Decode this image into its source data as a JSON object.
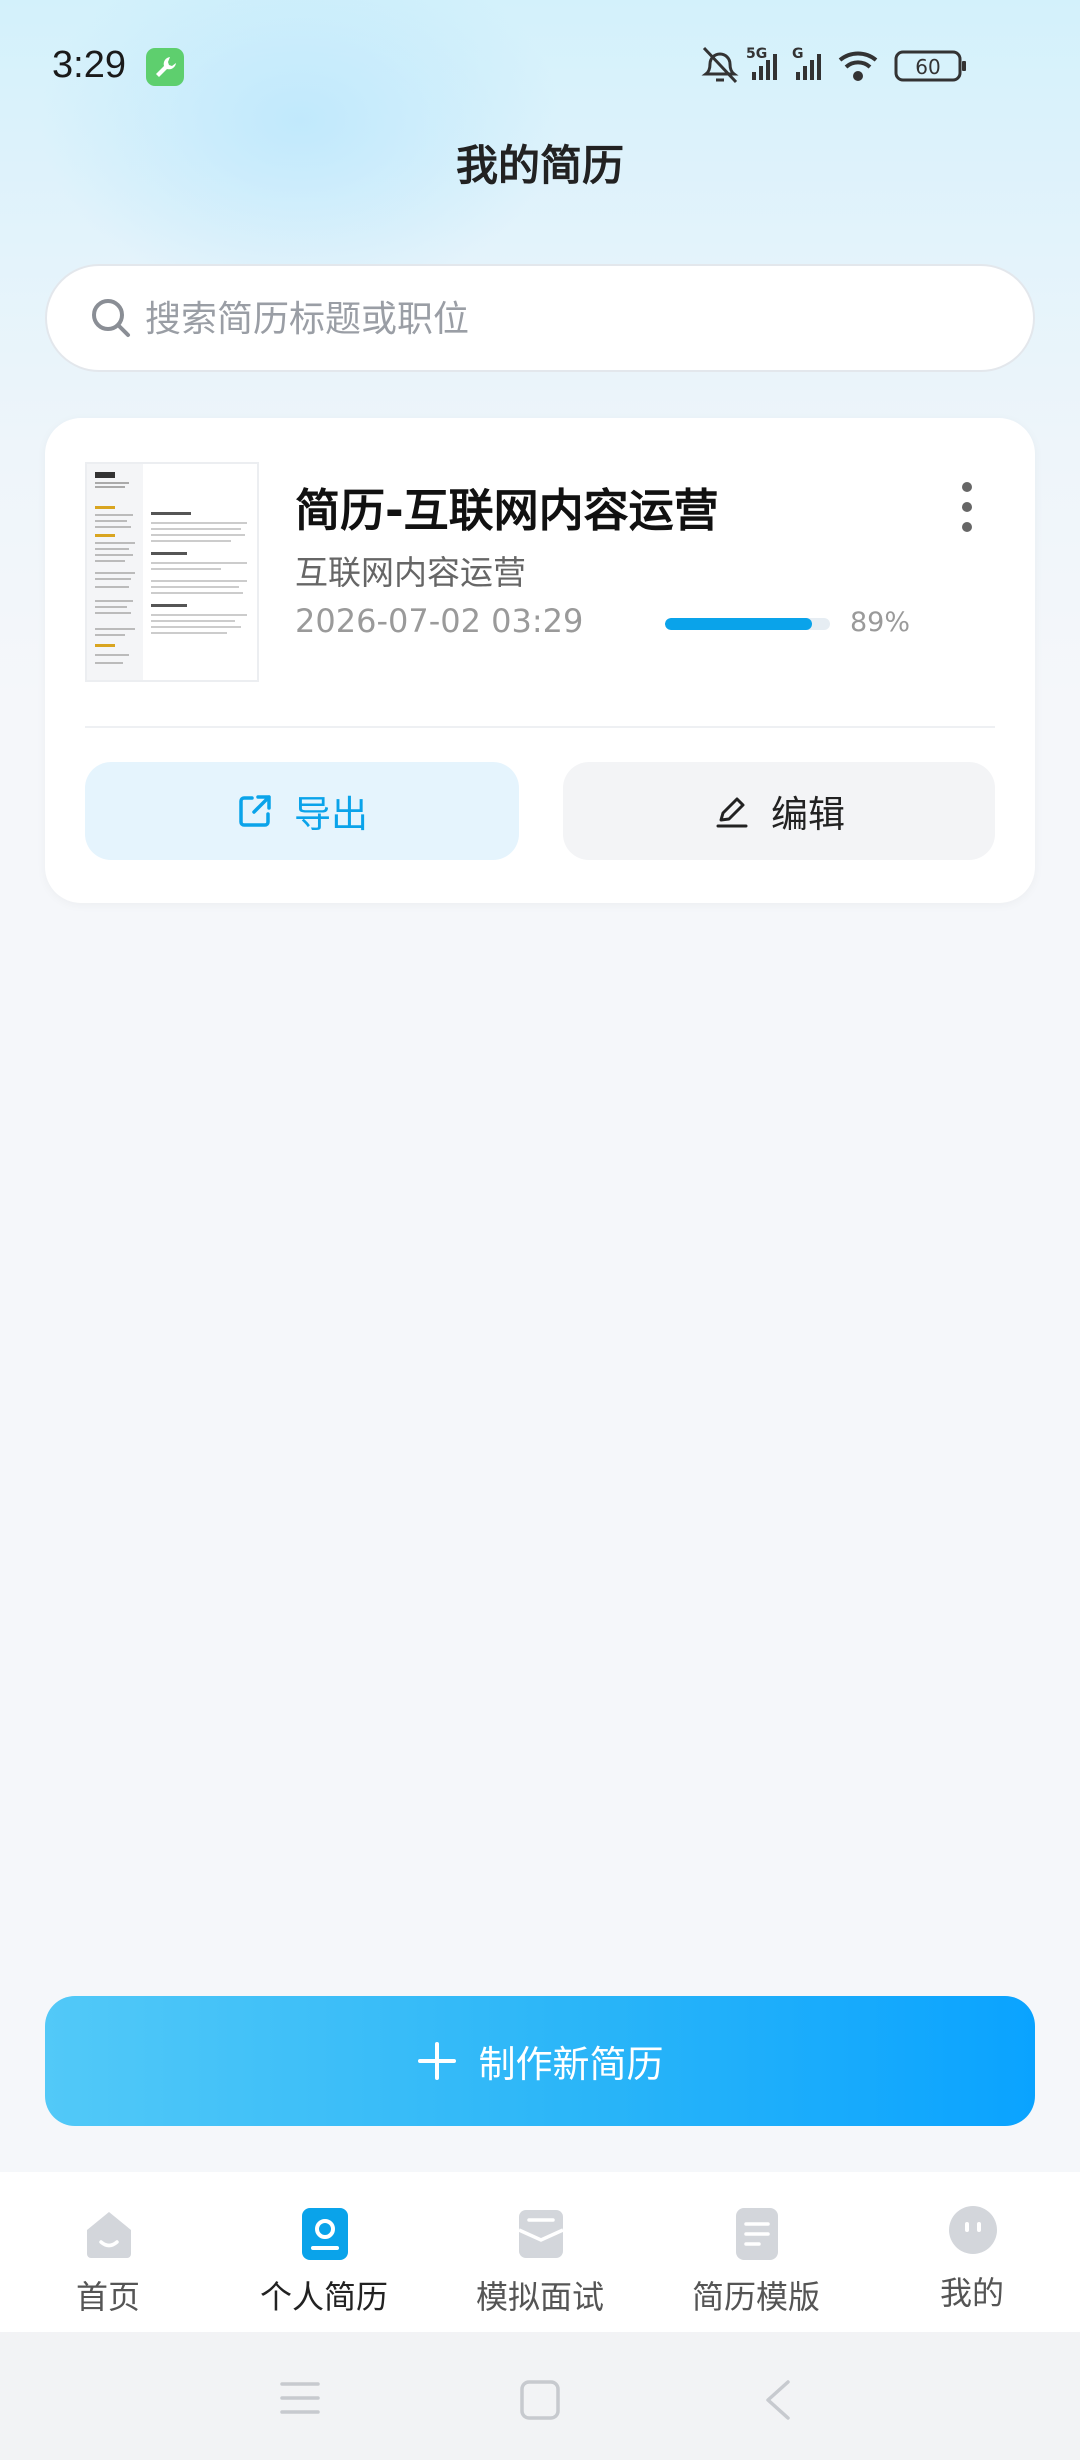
{
  "status_bar": {
    "time": "3:29",
    "network_1": "5G",
    "network_2": "G",
    "battery": "60"
  },
  "page": {
    "title": "我的简历"
  },
  "search": {
    "placeholder": "搜索简历标题或职位",
    "value": ""
  },
  "resume": {
    "title": "简历-互联网内容运营",
    "position": "互联网内容运营",
    "date": "2026-07-02 03:29",
    "progress_percent": 89,
    "progress_text": "89%",
    "export_label": "导出",
    "edit_label": "编辑"
  },
  "create": {
    "label": "制作新简历"
  },
  "tabs": [
    {
      "label": "首页",
      "icon": "home-icon"
    },
    {
      "label": "个人简历",
      "icon": "resume-icon",
      "active": true
    },
    {
      "label": "模拟面试",
      "icon": "interview-icon"
    },
    {
      "label": "简历模版",
      "icon": "template-icon"
    },
    {
      "label": "我的",
      "icon": "profile-icon"
    }
  ],
  "colors": {
    "accent": "#0aa3ea",
    "accent_light": "#e5f4fd",
    "tab_inactive": "#d3d6db"
  }
}
